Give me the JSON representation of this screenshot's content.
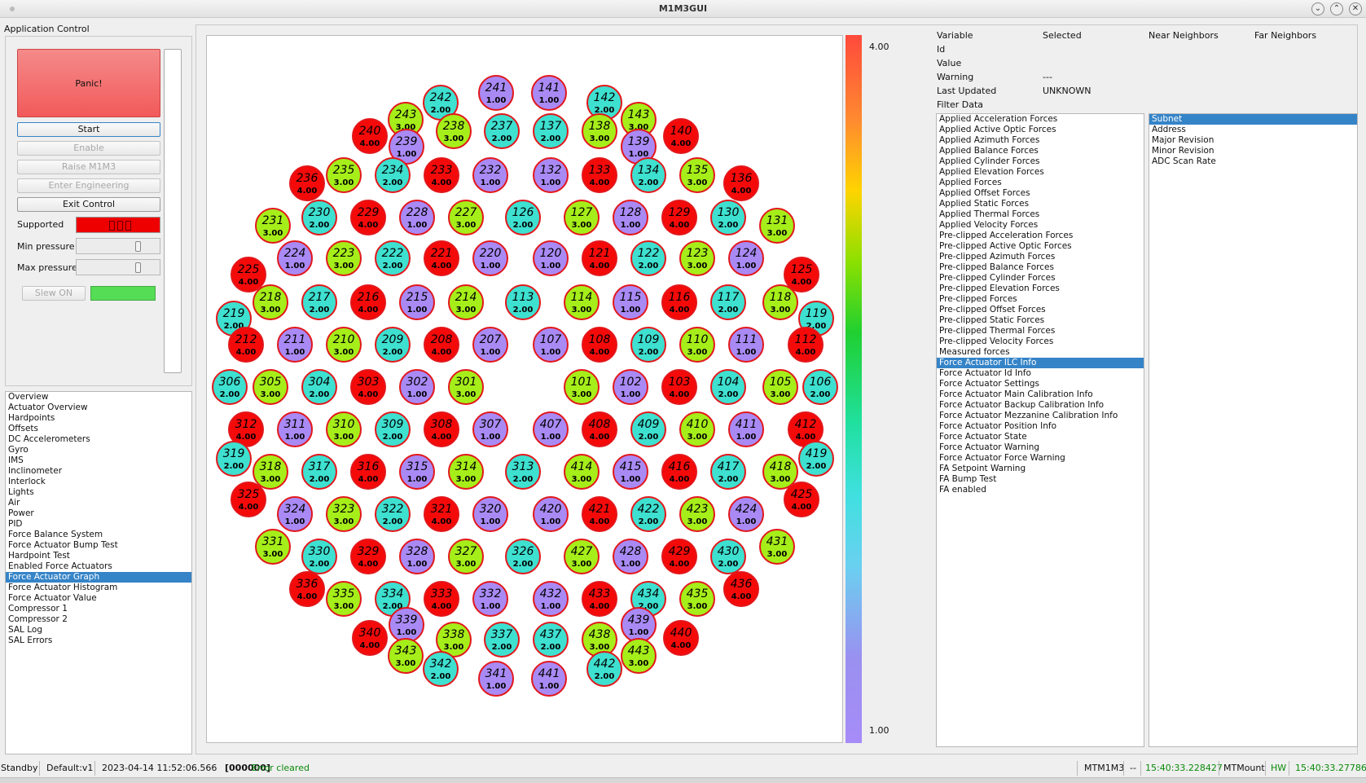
{
  "window": {
    "title": "M1M3GUI"
  },
  "app_control": {
    "title": "Application Control",
    "panic_label": "Panic!",
    "start_label": "Start",
    "enable_label": "Enable",
    "raise_label": "Raise M1M3",
    "engineering_label": "Enter Engineering",
    "exit_label": "Exit Control",
    "supported_label": "Supported",
    "min_pressure_label": "Min pressure",
    "max_pressure_label": "Max pressure",
    "slew_label": "Slew ON",
    "supported_color": "#ee0000",
    "slew_indicator_color": "#55dd55"
  },
  "nav": {
    "items": [
      "Overview",
      "Actuator Overview",
      "Hardpoints",
      "Offsets",
      "DC Accelerometers",
      "Gyro",
      "IMS",
      "Inclinometer",
      "Interlock",
      "Lights",
      "Air",
      "Power",
      "PID",
      "Force Balance System",
      "Force Actuator Bump Test",
      "Hardpoint Test",
      "Enabled Force Actuators",
      "Force Actuator Graph",
      "Force Actuator Histogram",
      "Force Actuator Value",
      "Compressor 1",
      "Compressor 2",
      "SAL Log",
      "SAL Errors"
    ],
    "selected": "Force Actuator Graph"
  },
  "colorbar": {
    "max_label": "4.00",
    "min_label": "1.00"
  },
  "value_colors": {
    "1.00": "#a98af5",
    "2.00": "#3ee0d0",
    "3.00": "#a6ee1a",
    "4.00": "#f50a0a"
  },
  "info": {
    "headers": [
      "Variable",
      "Selected",
      "Near Neighbors",
      "Far Neighbors"
    ],
    "rows": [
      {
        "label": "Id",
        "value": ""
      },
      {
        "label": "Value",
        "value": ""
      },
      {
        "label": "Warning",
        "value": "---"
      },
      {
        "label": "Last Updated",
        "value": "UNKNOWN"
      }
    ],
    "filter_label": "Filter Data"
  },
  "filters": {
    "items": [
      "Applied Acceleration Forces",
      "Applied Active Optic Forces",
      "Applied Azimuth Forces",
      "Applied Balance Forces",
      "Applied Cylinder Forces",
      "Applied Elevation Forces",
      "Applied Forces",
      "Applied Offset Forces",
      "Applied Static Forces",
      "Applied Thermal Forces",
      "Applied Velocity Forces",
      "Pre-clipped Acceleration Forces",
      "Pre-clipped Active Optic Forces",
      "Pre-clipped Azimuth Forces",
      "Pre-clipped Balance Forces",
      "Pre-clipped Cylinder Forces",
      "Pre-clipped Elevation Forces",
      "Pre-clipped Forces",
      "Pre-clipped Offset Forces",
      "Pre-clipped Static Forces",
      "Pre-clipped Thermal Forces",
      "Pre-clipped Velocity Forces",
      "Measured forces",
      "Force Actuator ILC Info",
      "Force Actuator Id Info",
      "Force Actuator Settings",
      "Force Actuator Main Calibration Info",
      "Force Actuator Backup Calibration Info",
      "Force Actuator Mezzanine Calibration Info",
      "Force Actuator Position Info",
      "Force Actuator State",
      "Force Actuator Warning",
      "Force Actuator Force Warning",
      "FA Setpoint Warning",
      "FA Bump Test",
      "FA enabled"
    ],
    "selected": "Force Actuator ILC Info"
  },
  "fields": {
    "items": [
      "Subnet",
      "Address",
      "Major Revision",
      "Minor Revision",
      "ADC Scan Rate"
    ],
    "selected": "Subnet"
  },
  "status": {
    "state": "Standby",
    "config": "Default:v1",
    "timestamp": "2023-04-14 11:52:06.566",
    "code": "[000000]",
    "message": "Error cleared",
    "m1m3_label": "MTM1M3",
    "dash": "--",
    "m1m3_time": "15:40:33.228427",
    "mount_label": "MTMount",
    "hw_label": "HW",
    "mount_time": "15:40:33.277864"
  },
  "actuators": [
    {
      "id": "241",
      "v": "1.00"
    },
    {
      "id": "141",
      "v": "1.00"
    },
    {
      "id": "242",
      "v": "2.00"
    },
    {
      "id": "142",
      "v": "2.00"
    },
    {
      "id": "243",
      "v": "3.00"
    },
    {
      "id": "143",
      "v": "3.00"
    },
    {
      "id": "238",
      "v": "3.00"
    },
    {
      "id": "237",
      "v": "2.00"
    },
    {
      "id": "137",
      "v": "2.00"
    },
    {
      "id": "138",
      "v": "3.00"
    },
    {
      "id": "240",
      "v": "4.00"
    },
    {
      "id": "140",
      "v": "4.00"
    },
    {
      "id": "239",
      "v": "1.00"
    },
    {
      "id": "139",
      "v": "1.00"
    },
    {
      "id": "236",
      "v": "4.00"
    },
    {
      "id": "235",
      "v": "3.00"
    },
    {
      "id": "234",
      "v": "2.00"
    },
    {
      "id": "233",
      "v": "4.00"
    },
    {
      "id": "232",
      "v": "1.00"
    },
    {
      "id": "132",
      "v": "1.00"
    },
    {
      "id": "133",
      "v": "4.00"
    },
    {
      "id": "134",
      "v": "2.00"
    },
    {
      "id": "135",
      "v": "3.00"
    },
    {
      "id": "136",
      "v": "4.00"
    },
    {
      "id": "230",
      "v": "2.00"
    },
    {
      "id": "229",
      "v": "4.00"
    },
    {
      "id": "228",
      "v": "1.00"
    },
    {
      "id": "227",
      "v": "3.00"
    },
    {
      "id": "126",
      "v": "2.00"
    },
    {
      "id": "127",
      "v": "3.00"
    },
    {
      "id": "128",
      "v": "1.00"
    },
    {
      "id": "129",
      "v": "4.00"
    },
    {
      "id": "130",
      "v": "2.00"
    },
    {
      "id": "231",
      "v": "3.00"
    },
    {
      "id": "131",
      "v": "3.00"
    },
    {
      "id": "224",
      "v": "1.00"
    },
    {
      "id": "223",
      "v": "3.00"
    },
    {
      "id": "222",
      "v": "2.00"
    },
    {
      "id": "221",
      "v": "4.00"
    },
    {
      "id": "220",
      "v": "1.00"
    },
    {
      "id": "120",
      "v": "1.00"
    },
    {
      "id": "121",
      "v": "4.00"
    },
    {
      "id": "122",
      "v": "2.00"
    },
    {
      "id": "123",
      "v": "3.00"
    },
    {
      "id": "124",
      "v": "1.00"
    },
    {
      "id": "225",
      "v": "4.00"
    },
    {
      "id": "125",
      "v": "4.00"
    },
    {
      "id": "218",
      "v": "3.00"
    },
    {
      "id": "217",
      "v": "2.00"
    },
    {
      "id": "216",
      "v": "4.00"
    },
    {
      "id": "215",
      "v": "1.00"
    },
    {
      "id": "214",
      "v": "3.00"
    },
    {
      "id": "113",
      "v": "2.00"
    },
    {
      "id": "114",
      "v": "3.00"
    },
    {
      "id": "115",
      "v": "1.00"
    },
    {
      "id": "116",
      "v": "4.00"
    },
    {
      "id": "117",
      "v": "2.00"
    },
    {
      "id": "118",
      "v": "3.00"
    },
    {
      "id": "219",
      "v": "2.00"
    },
    {
      "id": "119",
      "v": "2.00"
    },
    {
      "id": "212",
      "v": "4.00"
    },
    {
      "id": "211",
      "v": "1.00"
    },
    {
      "id": "210",
      "v": "3.00"
    },
    {
      "id": "209",
      "v": "2.00"
    },
    {
      "id": "208",
      "v": "4.00"
    },
    {
      "id": "207",
      "v": "1.00"
    },
    {
      "id": "107",
      "v": "1.00"
    },
    {
      "id": "108",
      "v": "4.00"
    },
    {
      "id": "109",
      "v": "2.00"
    },
    {
      "id": "110",
      "v": "3.00"
    },
    {
      "id": "111",
      "v": "1.00"
    },
    {
      "id": "112",
      "v": "4.00"
    },
    {
      "id": "306",
      "v": "2.00"
    },
    {
      "id": "305",
      "v": "3.00"
    },
    {
      "id": "304",
      "v": "2.00"
    },
    {
      "id": "303",
      "v": "4.00"
    },
    {
      "id": "302",
      "v": "1.00"
    },
    {
      "id": "301",
      "v": "3.00"
    },
    {
      "id": "101",
      "v": "3.00"
    },
    {
      "id": "102",
      "v": "1.00"
    },
    {
      "id": "103",
      "v": "4.00"
    },
    {
      "id": "104",
      "v": "2.00"
    },
    {
      "id": "105",
      "v": "3.00"
    },
    {
      "id": "106",
      "v": "2.00"
    },
    {
      "id": "312",
      "v": "4.00"
    },
    {
      "id": "311",
      "v": "1.00"
    },
    {
      "id": "310",
      "v": "3.00"
    },
    {
      "id": "309",
      "v": "2.00"
    },
    {
      "id": "308",
      "v": "4.00"
    },
    {
      "id": "307",
      "v": "1.00"
    },
    {
      "id": "407",
      "v": "1.00"
    },
    {
      "id": "408",
      "v": "4.00"
    },
    {
      "id": "409",
      "v": "2.00"
    },
    {
      "id": "410",
      "v": "3.00"
    },
    {
      "id": "411",
      "v": "1.00"
    },
    {
      "id": "412",
      "v": "4.00"
    },
    {
      "id": "319",
      "v": "2.00"
    },
    {
      "id": "419",
      "v": "2.00"
    },
    {
      "id": "318",
      "v": "3.00"
    },
    {
      "id": "317",
      "v": "2.00"
    },
    {
      "id": "316",
      "v": "4.00"
    },
    {
      "id": "315",
      "v": "1.00"
    },
    {
      "id": "314",
      "v": "3.00"
    },
    {
      "id": "313",
      "v": "2.00"
    },
    {
      "id": "414",
      "v": "3.00"
    },
    {
      "id": "415",
      "v": "1.00"
    },
    {
      "id": "416",
      "v": "4.00"
    },
    {
      "id": "417",
      "v": "2.00"
    },
    {
      "id": "418",
      "v": "3.00"
    },
    {
      "id": "325",
      "v": "4.00"
    },
    {
      "id": "425",
      "v": "4.00"
    },
    {
      "id": "324",
      "v": "1.00"
    },
    {
      "id": "323",
      "v": "3.00"
    },
    {
      "id": "322",
      "v": "2.00"
    },
    {
      "id": "321",
      "v": "4.00"
    },
    {
      "id": "320",
      "v": "1.00"
    },
    {
      "id": "420",
      "v": "1.00"
    },
    {
      "id": "421",
      "v": "4.00"
    },
    {
      "id": "422",
      "v": "2.00"
    },
    {
      "id": "423",
      "v": "3.00"
    },
    {
      "id": "424",
      "v": "1.00"
    },
    {
      "id": "331",
      "v": "3.00"
    },
    {
      "id": "431",
      "v": "3.00"
    },
    {
      "id": "330",
      "v": "2.00"
    },
    {
      "id": "329",
      "v": "4.00"
    },
    {
      "id": "328",
      "v": "1.00"
    },
    {
      "id": "327",
      "v": "3.00"
    },
    {
      "id": "326",
      "v": "2.00"
    },
    {
      "id": "427",
      "v": "3.00"
    },
    {
      "id": "428",
      "v": "1.00"
    },
    {
      "id": "429",
      "v": "4.00"
    },
    {
      "id": "430",
      "v": "2.00"
    },
    {
      "id": "336",
      "v": "4.00"
    },
    {
      "id": "436",
      "v": "4.00"
    },
    {
      "id": "335",
      "v": "3.00"
    },
    {
      "id": "334",
      "v": "2.00"
    },
    {
      "id": "333",
      "v": "4.00"
    },
    {
      "id": "332",
      "v": "1.00"
    },
    {
      "id": "432",
      "v": "1.00"
    },
    {
      "id": "433",
      "v": "4.00"
    },
    {
      "id": "434",
      "v": "2.00"
    },
    {
      "id": "435",
      "v": "3.00"
    },
    {
      "id": "339",
      "v": "1.00"
    },
    {
      "id": "439",
      "v": "1.00"
    },
    {
      "id": "340",
      "v": "4.00"
    },
    {
      "id": "440",
      "v": "4.00"
    },
    {
      "id": "338",
      "v": "3.00"
    },
    {
      "id": "337",
      "v": "2.00"
    },
    {
      "id": "437",
      "v": "2.00"
    },
    {
      "id": "438",
      "v": "3.00"
    },
    {
      "id": "343",
      "v": "3.00"
    },
    {
      "id": "443",
      "v": "3.00"
    },
    {
      "id": "342",
      "v": "2.00"
    },
    {
      "id": "442",
      "v": "2.00"
    },
    {
      "id": "341",
      "v": "1.00"
    },
    {
      "id": "441",
      "v": "1.00"
    }
  ]
}
